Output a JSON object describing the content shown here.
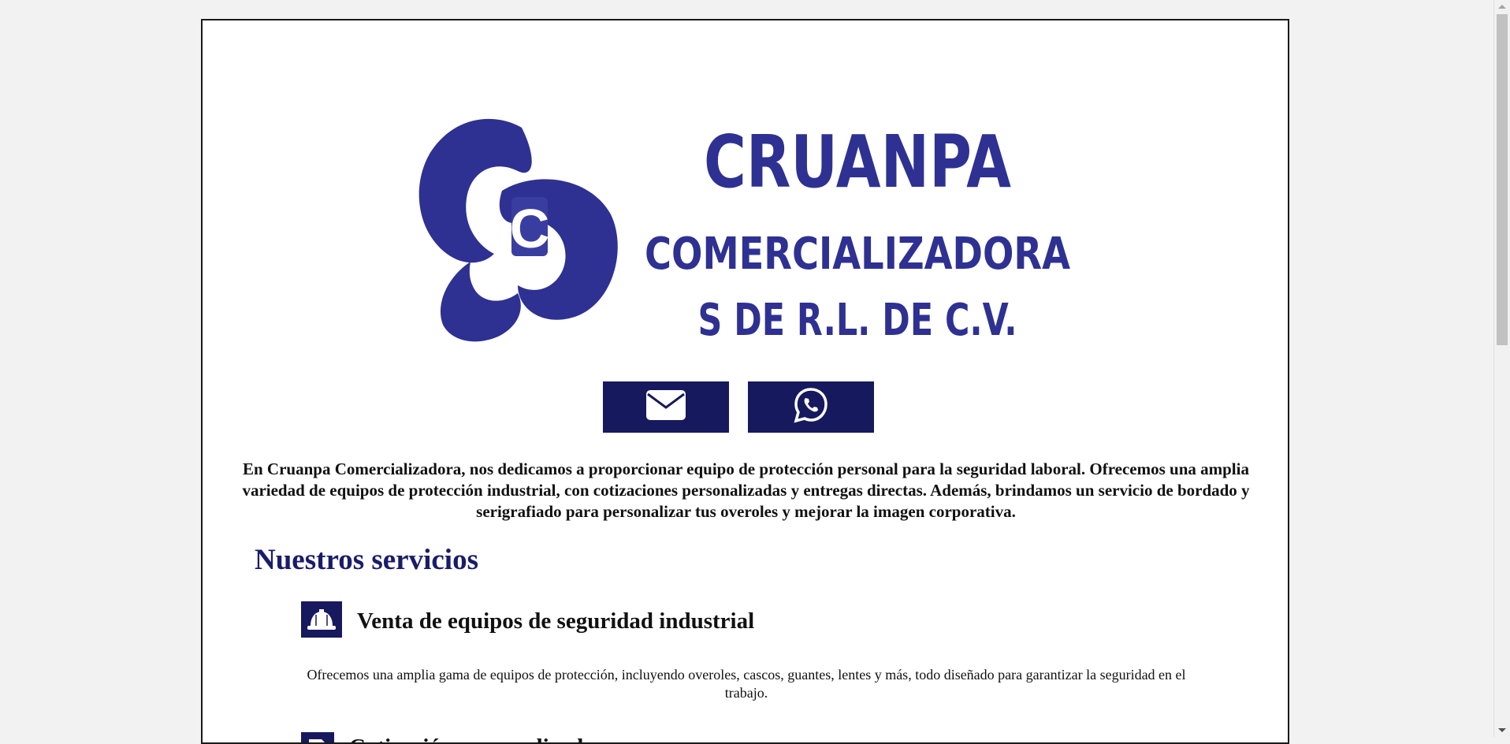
{
  "brand": {
    "name": "CRUANPA",
    "line2": "COMERCIALIZADORA",
    "line3": "S DE R.L. DE C.V.",
    "monogram": "C",
    "color": "#2e3192"
  },
  "contact": {
    "email_icon": "envelope-icon",
    "whatsapp_icon": "whatsapp-icon",
    "button_color": "#16195e"
  },
  "intro": "En Cruanpa Comercializadora, nos dedicamos a proporcionar equipo de protección personal para la seguridad laboral. Ofrecemos una amplia variedad de equipos de protección industrial, con cotizaciones personalizadas y entregas directas. Además, brindamos un servicio de bordado y serigrafiado para personalizar tus overoles y mejorar la imagen corporativa.",
  "services": {
    "heading": "Nuestros servicios",
    "items": [
      {
        "icon": "hard-hat-icon",
        "title": "Venta de equipos de seguridad industrial",
        "description": "Ofrecemos una amplia gama de equipos de protección, incluyendo overoles, cascos, guantes, lentes y más, todo diseñado para garantizar la seguridad en el trabajo."
      },
      {
        "icon": "invoice-icon",
        "title": "Cotización personalizada"
      }
    ]
  }
}
